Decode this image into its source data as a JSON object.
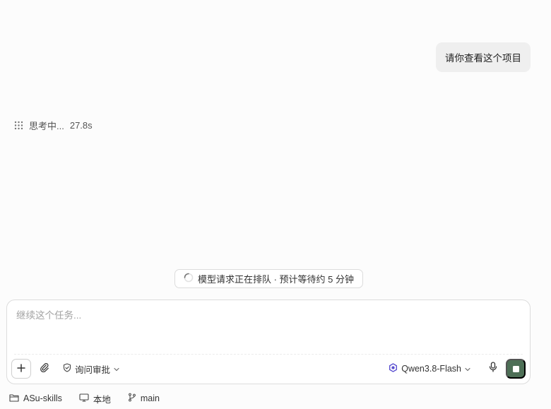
{
  "conversation": {
    "user_message": "请你查看这个项目",
    "thinking_label": "思考中...",
    "thinking_duration": "27.8s"
  },
  "queue_status": {
    "text": "模型请求正在排队 · 预计等待约 5 分钟"
  },
  "composer": {
    "placeholder": "继续这个任务...",
    "value": "",
    "approval_mode": "询问审批",
    "model_name": "Qwen3.8-Flash"
  },
  "footer": {
    "project": "ASu-skills",
    "environment": "本地",
    "branch": "main"
  },
  "colors": {
    "accent": "#4d6f56",
    "bubble_bg": "#efefef",
    "model_icon": "#5a4fd0"
  }
}
